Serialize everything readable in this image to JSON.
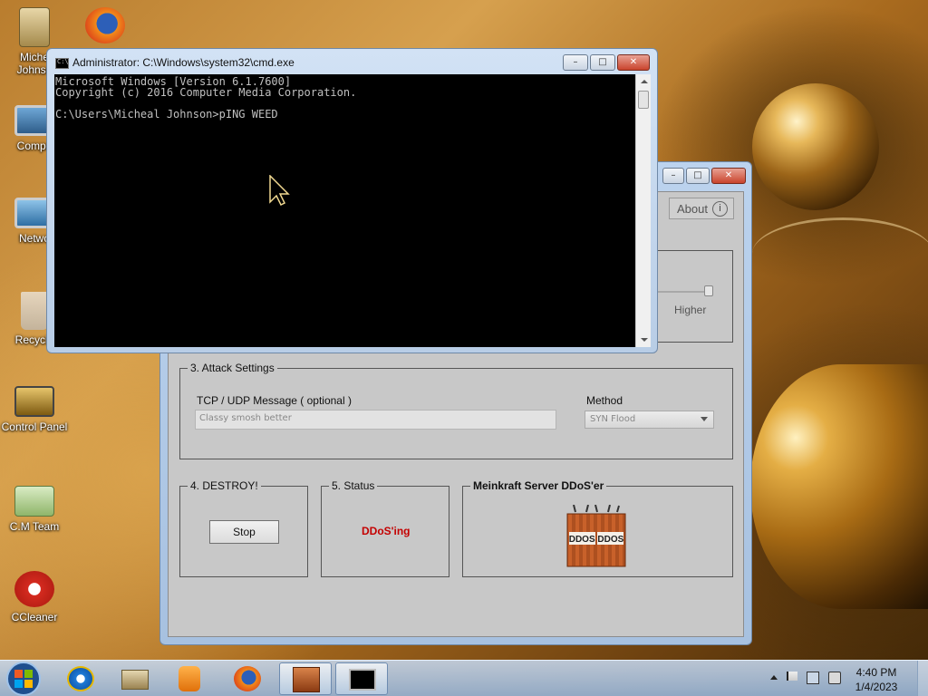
{
  "desktop": {
    "icons": [
      {
        "label": "Michea… Johnso…",
        "line1": "Miche",
        "line2": "Johnso",
        "icon": "user-folder-icon"
      },
      {
        "label": "",
        "icon": "firefox-icon"
      },
      {
        "label": "Compu",
        "icon": "computer-icon"
      },
      {
        "label": "Netwo",
        "icon": "network-icon"
      },
      {
        "label": "Recycle",
        "icon": "recycle-bin-icon"
      },
      {
        "label": "Control Panel",
        "icon": "control-panel-icon"
      },
      {
        "label": "C.M Team",
        "icon": "cm-team-icon"
      },
      {
        "label": "CCleaner",
        "icon": "ccleaner-icon"
      }
    ]
  },
  "cmd": {
    "title": "Administrator: C:\\Windows\\system32\\cmd.exe",
    "lines": [
      "Microsoft Windows [Version 6.1.7600]",
      "Copyright (c) 2016 Computer Media Corporation.",
      "",
      "C:\\Users\\Micheal Johnson>pING WEED"
    ]
  },
  "ddos": {
    "about_label": "About",
    "higher_label": "Higher",
    "attack_settings": {
      "legend": "3. Attack Settings",
      "message_label": "TCP / UDP Message  ( optional )",
      "message_value": "Classy smosh better",
      "method_label": "Method",
      "method_value": "SYN Flood"
    },
    "destroy": {
      "legend": "4. DESTROY!",
      "stop_label": "Stop"
    },
    "status": {
      "legend": "5. Status",
      "value": "DDoS'ing",
      "color": "#c40000"
    },
    "brand": {
      "legend": "Meinkraft Server DDoS'er",
      "logo_text": "DDOS DDOS"
    }
  },
  "window_controls": {
    "minimize": "–",
    "maximize": "□",
    "close": "✕"
  },
  "taskbar": {
    "items": [
      {
        "icon": "start-orb-icon"
      },
      {
        "icon": "internet-explorer-icon"
      },
      {
        "icon": "library-icon"
      },
      {
        "icon": "media-player-icon"
      },
      {
        "icon": "firefox-icon"
      },
      {
        "icon": "ddos-app-icon",
        "active": true
      },
      {
        "icon": "cmd-icon",
        "active": true
      }
    ],
    "clock_time": "4:40 PM",
    "clock_date": "1/4/2023"
  }
}
